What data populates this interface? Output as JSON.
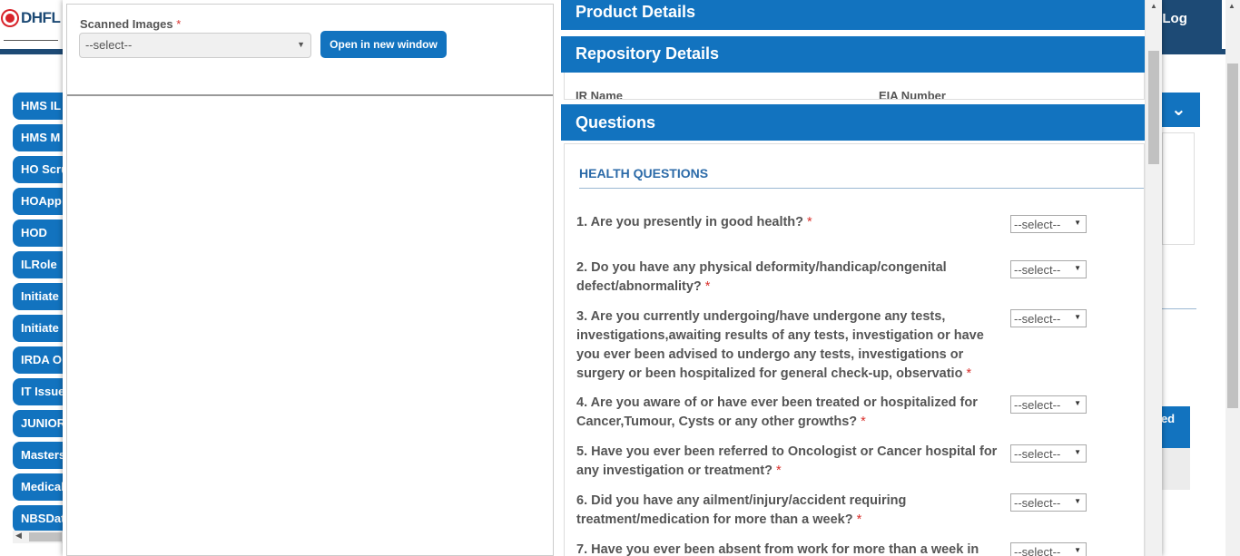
{
  "background": {
    "logo_text": "DHFL",
    "header_right_text": "| Log",
    "sidebar": [
      "HMS IL",
      "HMS M",
      "HO Scru",
      "HOApp",
      "HOD",
      "ILRole",
      "Initiate",
      "Initiate",
      "IRDA O",
      "IT Issue",
      "JUNIOR",
      "Masters",
      "Medical",
      "NBSDat"
    ],
    "right_button_text": "ned"
  },
  "left_pane": {
    "scanned_label": "Scanned Images",
    "required_mark": "*",
    "scanned_select_value": "--select--",
    "open_button": "Open in new window"
  },
  "right_pane": {
    "panels": {
      "product": "Product Details",
      "repository": "Repository Details",
      "questions": "Questions"
    },
    "repository_columns": [
      "IR Name",
      "EIA Number"
    ],
    "section_title": "HEALTH QUESTIONS",
    "select_placeholder": "--select--",
    "required_mark": "*",
    "questions": [
      "1. Are you presently in good health?",
      "2. Do you have any physical deformity/handicap/congenital defect/abnormality?",
      "3. Are you currently undergoing/have undergone any tests, investigations,awaiting results of any tests, investigation or have you ever been advised to undergo any tests, investigations or surgery or been hospitalized for general check-up, observatio",
      "4. Are you aware of or have ever been treated or hospitalized for Cancer,Tumour, Cysts or any other growths?",
      "5. Have you ever been referred to Oncologist or Cancer hospital for any investigation or treatment?",
      "6. Did you have any ailment/injury/accident requiring treatment/medication for more than a week?",
      "7. Have you ever been absent from work for more than a week in"
    ]
  }
}
